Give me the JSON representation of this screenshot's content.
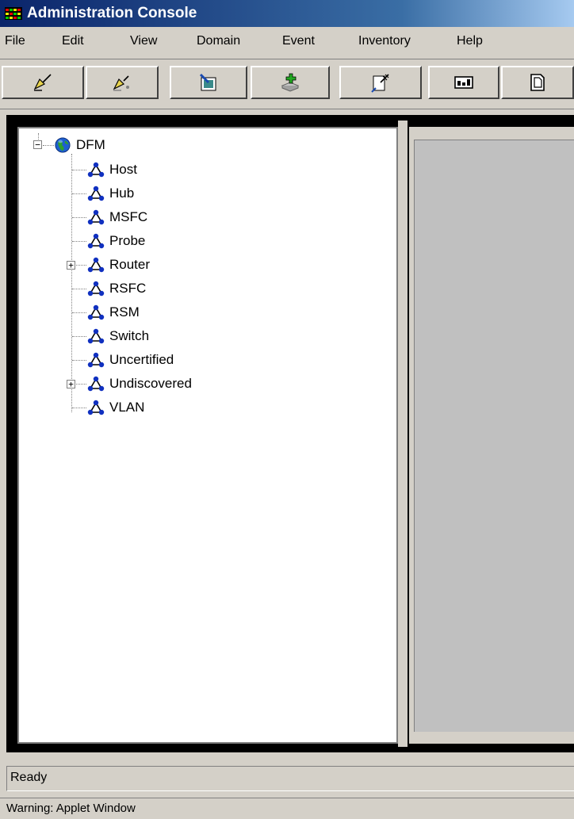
{
  "window": {
    "title": "Administration Console",
    "icon": "app-icon"
  },
  "menu": [
    {
      "label": "File"
    },
    {
      "label": "Edit"
    },
    {
      "label": "View"
    },
    {
      "label": "Domain"
    },
    {
      "label": "Event"
    },
    {
      "label": "Inventory"
    },
    {
      "label": "Help"
    }
  ],
  "toolbar": [
    {
      "icon": "connect-icon"
    },
    {
      "icon": "disconnect-icon"
    },
    {
      "icon": "edit-domain-icon"
    },
    {
      "icon": "add-icon"
    },
    {
      "icon": "configure-icon"
    },
    {
      "icon": "display-icon"
    },
    {
      "icon": "new-window-icon"
    }
  ],
  "tree": {
    "root": {
      "label": "DFM",
      "icon": "globe-icon"
    },
    "children": [
      {
        "label": "Host"
      },
      {
        "label": "Hub"
      },
      {
        "label": "MSFC"
      },
      {
        "label": "Probe"
      },
      {
        "label": "Router",
        "expandable": true
      },
      {
        "label": "RSFC"
      },
      {
        "label": "RSM"
      },
      {
        "label": "Switch"
      },
      {
        "label": "Uncertified"
      },
      {
        "label": "Undiscovered",
        "expandable": true
      },
      {
        "label": "VLAN"
      }
    ]
  },
  "status": {
    "text": "Ready"
  },
  "applet_warning": {
    "text": "Warning: Applet Window"
  }
}
